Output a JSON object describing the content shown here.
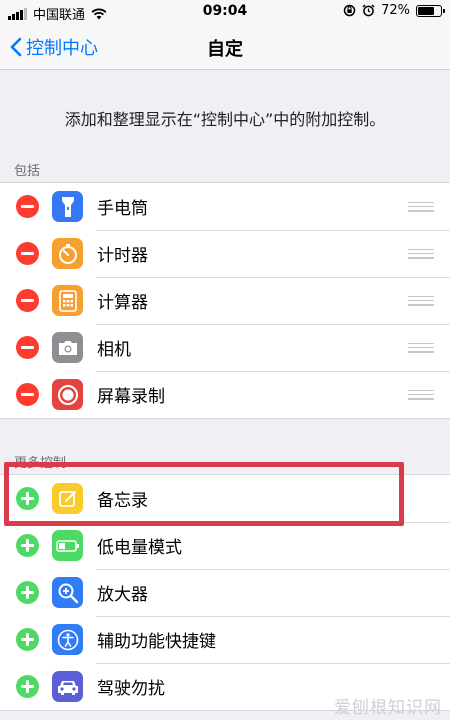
{
  "status_bar": {
    "carrier": "中国联通",
    "time": "09:04",
    "battery_percent": "72%",
    "battery_level": 0.72
  },
  "nav": {
    "back_label": "控制中心",
    "title": "自定"
  },
  "description": "添加和整理显示在“控制中心”中的附加控制。",
  "included": {
    "header": "包括",
    "items": [
      {
        "label": "手电筒",
        "icon": "flashlight-icon",
        "color": "#3478f6"
      },
      {
        "label": "计时器",
        "icon": "timer-icon",
        "color": "#f7a030"
      },
      {
        "label": "计算器",
        "icon": "calculator-icon",
        "color": "#f7a030"
      },
      {
        "label": "相机",
        "icon": "camera-icon",
        "color": "#8e8e93"
      },
      {
        "label": "屏幕录制",
        "icon": "screen-recording-icon",
        "color": "#e5433d"
      }
    ]
  },
  "more": {
    "header": "更多控制",
    "items": [
      {
        "label": "备忘录",
        "icon": "notes-icon",
        "color": "#f9cc2c"
      },
      {
        "label": "低电量模式",
        "icon": "low-power-mode-icon",
        "color": "#4cd964"
      },
      {
        "label": "放大器",
        "icon": "magnifier-icon",
        "color": "#2f7cf6"
      },
      {
        "label": "辅助功能快捷键",
        "icon": "accessibility-icon",
        "color": "#2f7cf6"
      },
      {
        "label": "驾驶勿扰",
        "icon": "do-not-disturb-driving-icon",
        "color": "#5b5fd6"
      }
    ]
  },
  "watermark": "爱刨根知识网"
}
